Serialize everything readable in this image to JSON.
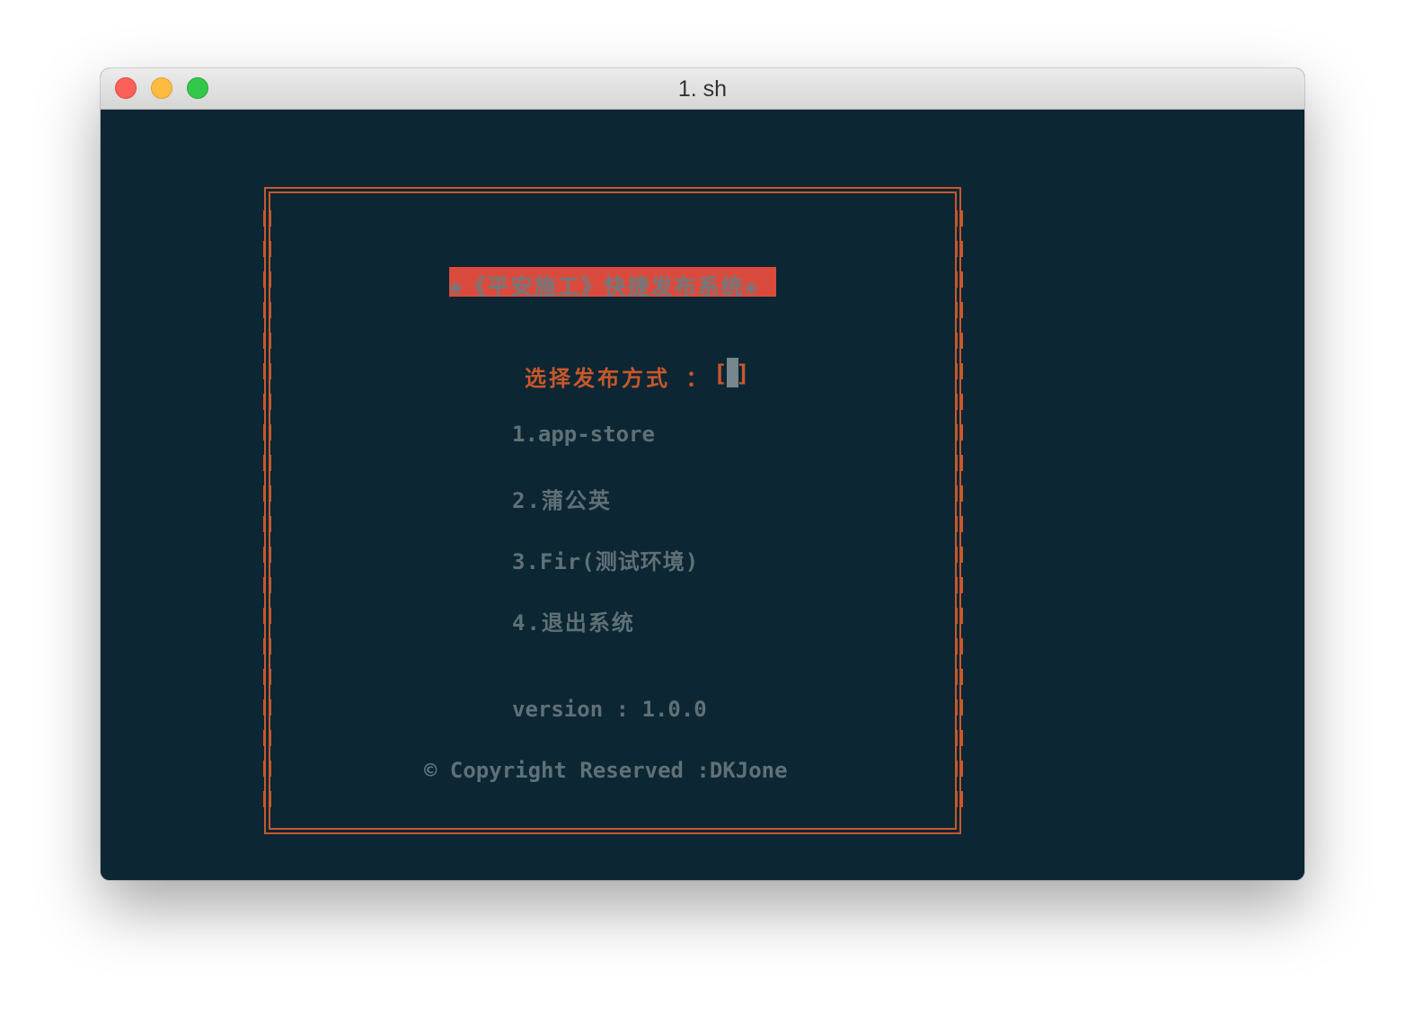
{
  "window": {
    "title": "1. sh"
  },
  "terminal": {
    "banner_title": "❀《平安施工》快捷发布系统❀",
    "prompt_label": "选择发布方式 ：",
    "cursor_open": "[",
    "cursor_close": "]",
    "options": [
      "1.app-store",
      "2.蒲公英",
      "3.Fir(测试环境)",
      "4.退出系统"
    ],
    "version": "version : 1.0.0",
    "copyright": "© Copyright Reserved :DKJone"
  },
  "colors": {
    "background": "#0c2633",
    "accent_orange": "#c8582c",
    "banner_red": "#db4b3d",
    "text_gray": "#5f7177"
  }
}
